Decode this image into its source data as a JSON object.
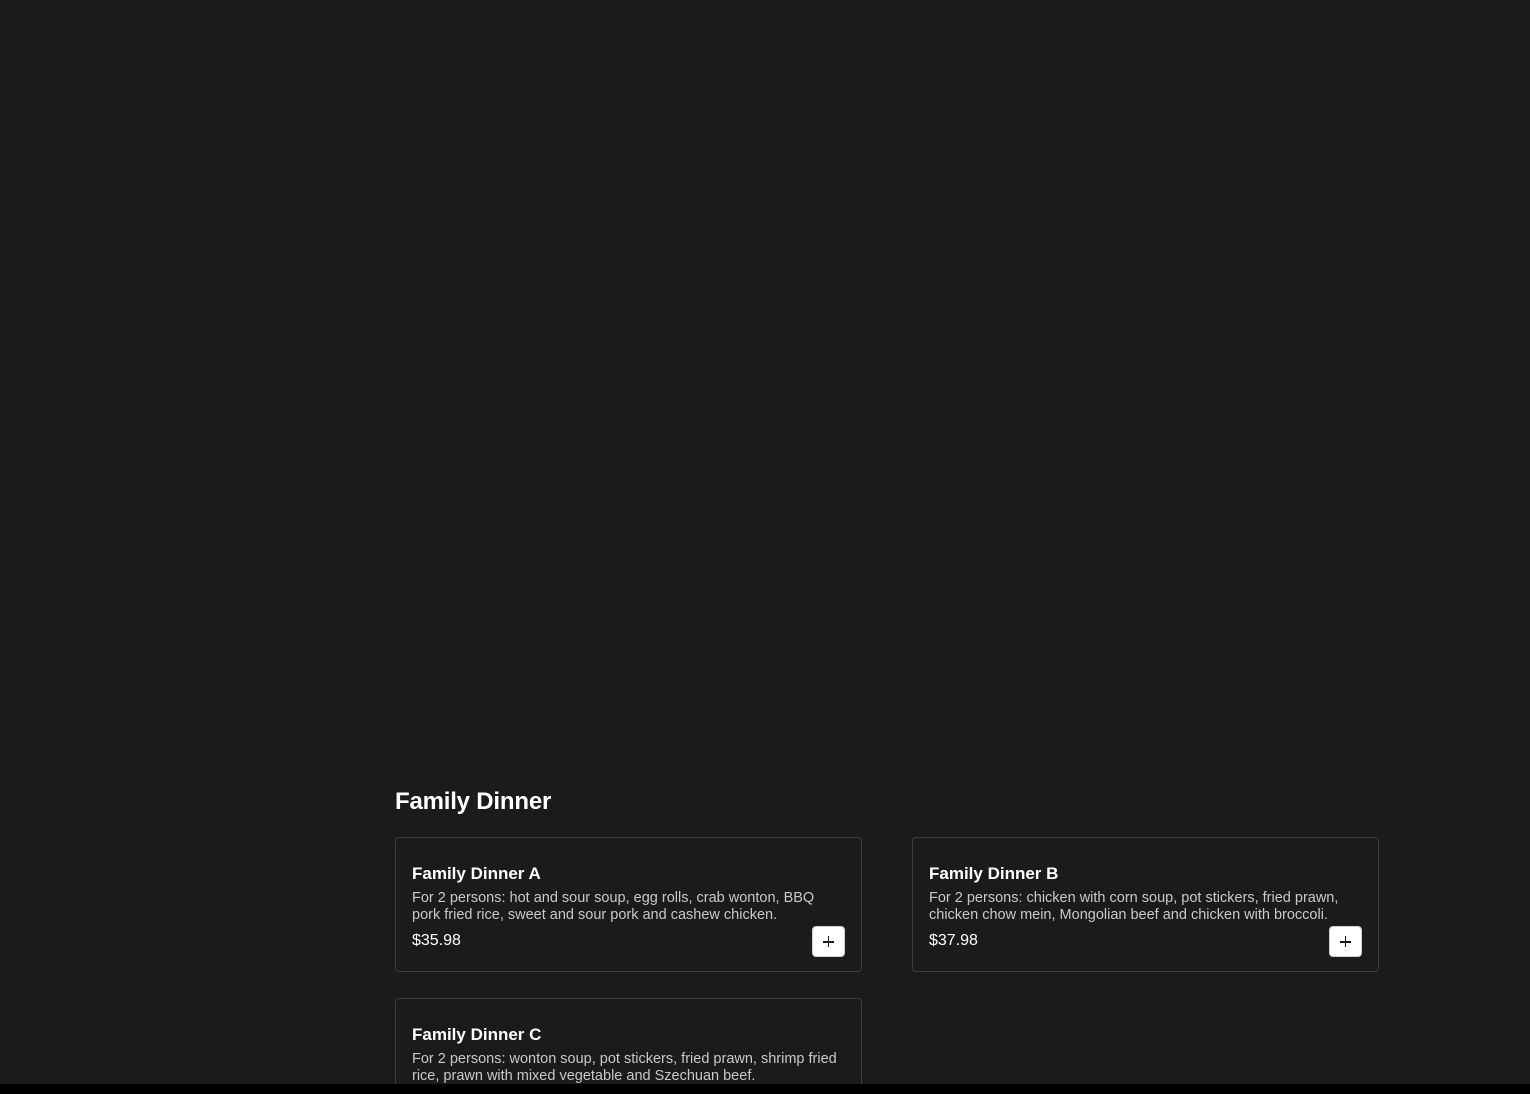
{
  "section": {
    "title": "Family Dinner"
  },
  "items": [
    {
      "name": "Family Dinner A",
      "description": "For 2 persons: hot and sour soup, egg rolls, crab wonton, BBQ pork fried rice, sweet and sour pork and cashew chicken.",
      "price": "$35.98",
      "add_icon": "plus-icon"
    },
    {
      "name": "Family Dinner B",
      "description": "For 2 persons: chicken with corn soup, pot stickers, fried prawn, chicken chow mein, Mongolian beef and chicken with broccoli.",
      "price": "$37.98",
      "add_icon": "plus-icon"
    },
    {
      "name": "Family Dinner C",
      "description": "For 2 persons: wonton soup, pot stickers, fried prawn, shrimp fried rice, prawn with mixed vegetable and Szechuan beef.",
      "price": "",
      "add_icon": "plus-icon"
    }
  ],
  "colors": {
    "background": "#1b1b1b",
    "card_border": "#3d3d3d",
    "text_primary": "#ffffff",
    "text_secondary": "#c9c9c9"
  }
}
